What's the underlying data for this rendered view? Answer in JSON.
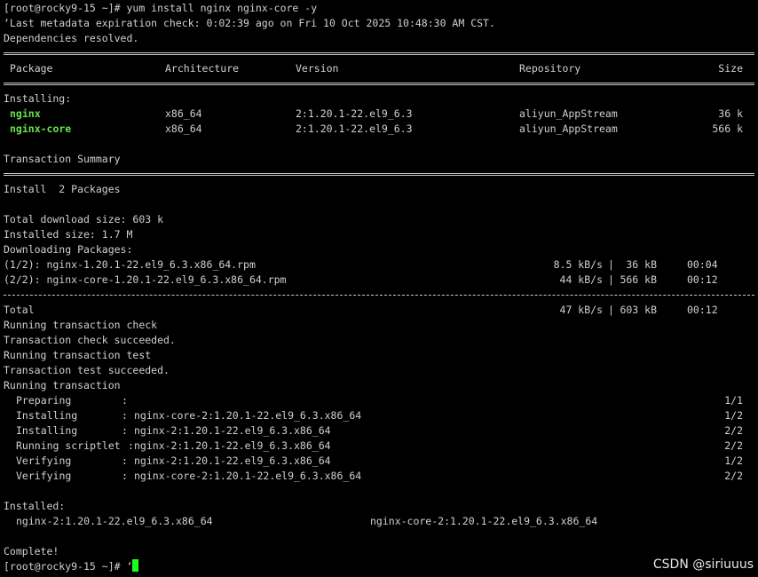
{
  "cmd": {
    "prompt": "[root@rocky9-15 ~]# ",
    "text": "yum install nginx nginx-core -y"
  },
  "meta_line": "‘Last metadata expiration check: 0:02:39 ago on Fri 10 Oct 2025 10:48:30 AM CST.",
  "deps_line": "Dependencies resolved.",
  "table": {
    "headers": {
      "package": "Package",
      "arch": "Architecture",
      "version": "Version",
      "repo": "Repository",
      "size": "Size"
    },
    "installing_label": "Installing:",
    "rows": [
      {
        "package": "nginx",
        "arch": "x86_64",
        "version": "2:1.20.1-22.el9_6.3",
        "repo": "aliyun_AppStream",
        "size": "36 k"
      },
      {
        "package": "nginx-core",
        "arch": "x86_64",
        "version": "2:1.20.1-22.el9_6.3",
        "repo": "aliyun_AppStream",
        "size": "566 k"
      }
    ]
  },
  "summary": {
    "title": "Transaction Summary",
    "install": "Install  2 Packages"
  },
  "sizes": {
    "download": "Total download size: 603 k",
    "installed": "Installed size: 1.7 M"
  },
  "downloading": {
    "label": "Downloading Packages:",
    "items": [
      {
        "file": "(1/2): nginx-1.20.1-22.el9_6.3.x86_64.rpm",
        "speed": "8.5 kB/s",
        "size": " 36 kB",
        "time": "00:04"
      },
      {
        "file": "(2/2): nginx-core-1.20.1-22.el9_6.3.x86_64.rpm",
        "speed": "44 kB/s",
        "size": "566 kB",
        "time": "00:12"
      }
    ],
    "total": {
      "label": "Total",
      "speed": "47 kB/s",
      "size": "603 kB",
      "time": "00:12"
    }
  },
  "tx_messages": [
    "Running transaction check",
    "Transaction check succeeded.",
    "Running transaction test",
    "Transaction test succeeded.",
    "Running transaction"
  ],
  "steps": [
    {
      "name": "Preparing",
      "pkg": "",
      "progress": "1/1"
    },
    {
      "name": "Installing",
      "pkg": "nginx-core-2:1.20.1-22.el9_6.3.x86_64",
      "progress": "1/2"
    },
    {
      "name": "Installing",
      "pkg": "nginx-2:1.20.1-22.el9_6.3.x86_64",
      "progress": "2/2"
    },
    {
      "name": "Running scriptlet",
      "pkg": "nginx-2:1.20.1-22.el9_6.3.x86_64",
      "progress": "2/2"
    },
    {
      "name": "Verifying",
      "pkg": "nginx-2:1.20.1-22.el9_6.3.x86_64",
      "progress": "1/2"
    },
    {
      "name": "Verifying",
      "pkg": "nginx-core-2:1.20.1-22.el9_6.3.x86_64",
      "progress": "2/2"
    }
  ],
  "installed": {
    "label": "Installed:",
    "packages": [
      "nginx-2:1.20.1-22.el9_6.3.x86_64",
      "nginx-core-2:1.20.1-22.el9_6.3.x86_64"
    ]
  },
  "complete": "Complete!",
  "final_prompt": {
    "prompt": "[root@rocky9-15 ~]# ",
    "text": "‘"
  },
  "watermark": "CSDN @siriuuus",
  "colors": {
    "background": "#000000",
    "text": "#d0d0d0",
    "package_highlight": "#66e34a",
    "cursor": "#1aff1a"
  }
}
